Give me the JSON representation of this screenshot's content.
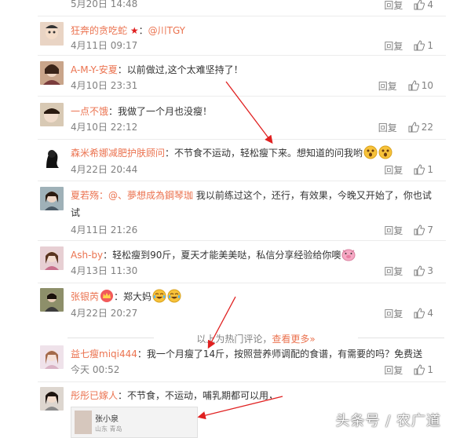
{
  "top": {
    "time": "5月20日 14:48",
    "reply": "回复",
    "likes": "4"
  },
  "comments": [
    {
      "user": "狂奔的贪吃蛇",
      "badge": "★",
      "mention": "@川TGY",
      "text": "",
      "time": "4月11日 09:17",
      "reply": "回复",
      "likes": "1"
    },
    {
      "user": "A-M-Y-安夏",
      "text": "：以前做过,这个太难坚持了！",
      "time": "4月10日 23:31",
      "reply": "回复",
      "likes": "10"
    },
    {
      "user": "一点不饿",
      "text": "：我做了一个月也没瘦！",
      "time": "4月10日 22:12",
      "reply": "回复",
      "likes": "22"
    },
    {
      "user": "森米希娜减肥护肤顾问",
      "text": "：不节食不运动，轻松瘦下来。想知道的问我哟",
      "time": "4月22日 20:44",
      "reply": "回复",
      "likes": "1"
    },
    {
      "user": "夏若殇",
      "mention": "：@、夢想成為鋼琴珈",
      "text": " 我以前练过这个，还行，有效果，今晚又开始了，你也试试",
      "time": "4月11日 21:26",
      "reply": "回复",
      "likes": "7"
    },
    {
      "user": "Ash-by",
      "text": "：轻松瘦到90斤，夏天才能美美哒，私信分享经验给你噢",
      "time": "4月13日 11:30",
      "reply": "回复",
      "likes": "3"
    },
    {
      "user": "张银芮",
      "text": "：郑大妈",
      "time": "4月22日 20:27",
      "reply": "回复",
      "likes": "4"
    },
    {
      "user": "益七瘦miqi444",
      "text": "：我一个月瘦了14斤，按照营养师调配的食谱，有需要的吗？免费送",
      "time": "今天 00:52",
      "reply": "回复",
      "likes": "1"
    },
    {
      "user": "彤彤已嫁人",
      "text": "：不节食，不运动，哺乳期都可以用，",
      "card_name": "张小泉",
      "card_loc": "山东 青岛"
    }
  ],
  "divider": {
    "prefix": "以上为热门评论，",
    "more": "查看更多»"
  },
  "watermark": "头条号 / 农广道",
  "colors": {
    "username": "#eb7350",
    "arrow": "#e02020"
  }
}
